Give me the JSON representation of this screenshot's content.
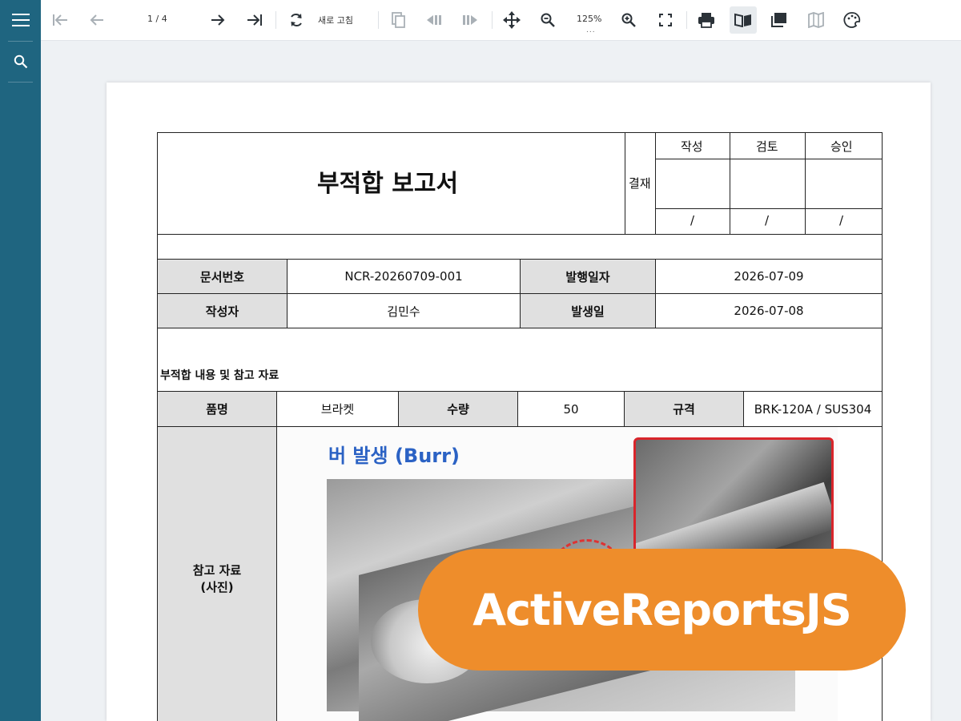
{
  "toolbar": {
    "page_indicator": "1 / 4",
    "refresh_label": "새로 고침",
    "zoom_level": "125%",
    "zoom_more": "...",
    "icons": [
      "first-page-icon",
      "prev-page-icon",
      "next-page-icon",
      "last-page-icon",
      "refresh-icon",
      "export-icon",
      "back-icon",
      "forward-icon",
      "pan-icon",
      "zoom-out-icon",
      "zoom-in-icon",
      "fullscreen-icon",
      "print-icon",
      "single-page-icon",
      "continuous-icon",
      "galley-icon",
      "theme-icon"
    ]
  },
  "sidebar": {
    "icons": [
      "menu-icon",
      "search-icon"
    ]
  },
  "report": {
    "title": "부적합 보고서",
    "approval": {
      "label": "결재",
      "columns": [
        "작성",
        "검토",
        "승인"
      ],
      "date_slash": "/"
    },
    "info": {
      "doc_no_label": "문서번호",
      "doc_no": "NCR-20260709-001",
      "issue_date_label": "발행일자",
      "issue_date": "2026-07-09",
      "author_label": "작성자",
      "author": "김민수",
      "occur_date_label": "발생일",
      "occur_date": "2026-07-08"
    },
    "section_title": "부적합 내용 및 참고 자료",
    "item": {
      "name_label": "품명",
      "name": "브라켓",
      "qty_label": "수량",
      "qty": "50",
      "spec_label": "규격",
      "spec": "BRK-120A / SUS304"
    },
    "reference_label_line1": "참고 자료",
    "reference_label_line2": "(사진)",
    "photo_title": "버 발생 (Burr)"
  },
  "badge": {
    "text": "ActiveReportsJS"
  },
  "colors": {
    "sidebar": "#1f6580",
    "badge": "#ee8d2b",
    "photo_title": "#2b62c4",
    "inset_border": "#d9252b"
  }
}
